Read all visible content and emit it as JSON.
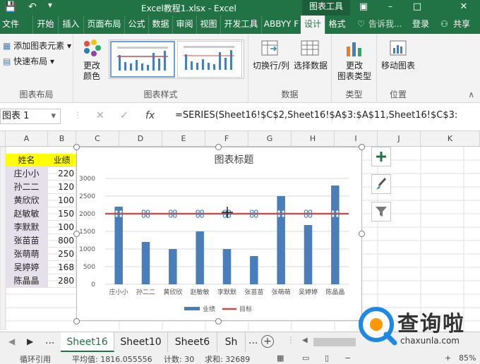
{
  "window": {
    "title": "Excel教程1.xlsx - Excel",
    "context_tab": "图表工具"
  },
  "tabs": [
    "文件",
    "开始",
    "插入",
    "页面布局",
    "公式",
    "数据",
    "审阅",
    "视图",
    "开发工具",
    "ABBYY F",
    "设计",
    "格式"
  ],
  "tell_me": "告诉我...",
  "login": "登录",
  "share": "共享",
  "ribbon": {
    "add_element": "添加图表元素",
    "quick_layout": "快速布局",
    "change_colors_1": "更改",
    "change_colors_2": "颜色",
    "group_layout": "图表布局",
    "group_styles": "图表样式",
    "switch_rowcol": "切换行/列",
    "select_data": "选择数据",
    "group_data": "数据",
    "change_type_1": "更改",
    "change_type_2": "图表类型",
    "group_type": "类型",
    "move_chart": "移动图表",
    "group_location": "位置"
  },
  "formula_bar": {
    "name_box": "图表 1",
    "fx": "fx",
    "formula": "=SERIES(Sheet16!$C$2,Sheet16!$A$3:$A$11,Sheet16!$C$3:"
  },
  "columns": [
    "A",
    "B",
    "C",
    "D",
    "E",
    "F",
    "G",
    "H",
    "I",
    "J",
    "K"
  ],
  "table": {
    "header_name": "姓名",
    "header_value": "业绩",
    "names": [
      "庄小小",
      "孙二二",
      "黄欣欣",
      "赵敏敏",
      "李默默",
      "张苗苗",
      "张萌萌",
      "吴婷婷",
      "陈晶晶"
    ],
    "values": [
      "220",
      "120",
      "100",
      "150",
      "100",
      "800",
      "250",
      "168",
      "280"
    ]
  },
  "chart_data": {
    "type": "bar",
    "title": "图表标题",
    "categories": [
      "庄小小",
      "孙二二",
      "黄欣欣",
      "赵敏敏",
      "李默默",
      "张苗苗",
      "张萌萌",
      "吴婷婷",
      "陈晶晶"
    ],
    "series": [
      {
        "name": "业绩",
        "type": "bar",
        "values": [
          2200,
          1200,
          1000,
          1500,
          1000,
          800,
          2500,
          1680,
          2800
        ],
        "color": "#4a7ebb"
      },
      {
        "name": "目标",
        "type": "line",
        "values": [
          2000,
          2000,
          2000,
          2000,
          2000,
          2000,
          2000,
          2000,
          2000
        ],
        "color": "#c0504d"
      }
    ],
    "yticks": [
      "0",
      "500",
      "1000",
      "1500",
      "2000",
      "2500",
      "3000"
    ],
    "ylim": [
      0,
      3000
    ],
    "grid": true,
    "legend": "bottom"
  },
  "sheets": [
    "Sheet16",
    "Sheet10",
    "Sheet6",
    "Sh"
  ],
  "sheet_more": "...",
  "status": {
    "mode": "循环引用",
    "average": "平均值: 1816.055556",
    "count": "计数: 30",
    "sum": "求和: 32689",
    "zoom": "85%"
  },
  "watermark": {
    "text": "查询啦",
    "url": "chaxunla.com"
  },
  "colors": {
    "excel_green": "#217346",
    "bar_blue": "#4a7ebb",
    "line_red": "#c0504d",
    "name_fill": "#e6e0ec",
    "header_yellow": "#ffff00"
  }
}
